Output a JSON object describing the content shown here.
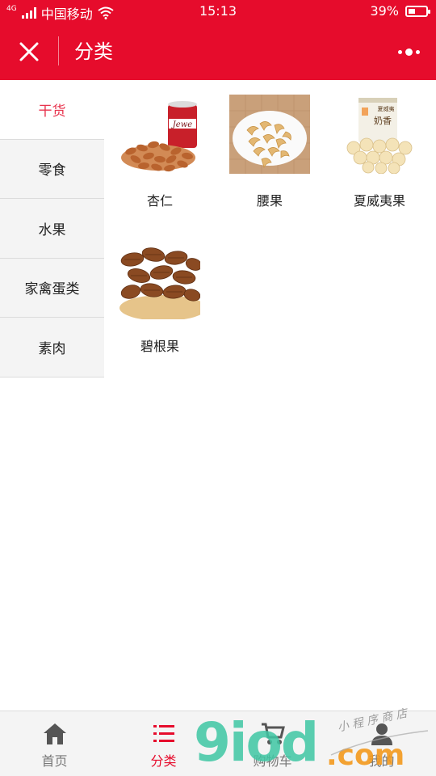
{
  "status_bar": {
    "network": "4G",
    "carrier": "中国移动",
    "time": "15:13",
    "battery_text": "39%",
    "battery_level": 0.39
  },
  "header": {
    "title": "分类",
    "close_icon": "close-icon",
    "more_icon": "more-dots-icon",
    "background_color": "#e60c2c"
  },
  "sidebar": {
    "items": [
      {
        "label": "干货",
        "active": true
      },
      {
        "label": "零食",
        "active": false
      },
      {
        "label": "水果",
        "active": false
      },
      {
        "label": "家禽蛋类",
        "active": false
      },
      {
        "label": "素肉",
        "active": false
      }
    ],
    "active_color": "#e8344e"
  },
  "products": [
    {
      "name": "杏仁",
      "image": "almonds-jar-photo"
    },
    {
      "name": "腰果",
      "image": "cashews-bowl-photo"
    },
    {
      "name": "夏威夷果",
      "image": "macadamia-can-photo"
    },
    {
      "name": "碧根果",
      "image": "pecans-bowl-photo"
    }
  ],
  "tabbar": {
    "tabs": [
      {
        "label": "首页",
        "icon": "home-icon",
        "active": false
      },
      {
        "label": "分类",
        "icon": "list-icon",
        "active": true
      },
      {
        "label": "购物车",
        "icon": "cart-icon",
        "active": false
      },
      {
        "label": "我的",
        "icon": "user-icon",
        "active": false
      }
    ],
    "active_color": "#e60c2c"
  },
  "watermark": {
    "logo": "9iod",
    "suffix": ".com",
    "tagline": "小 程 序 商 店"
  }
}
